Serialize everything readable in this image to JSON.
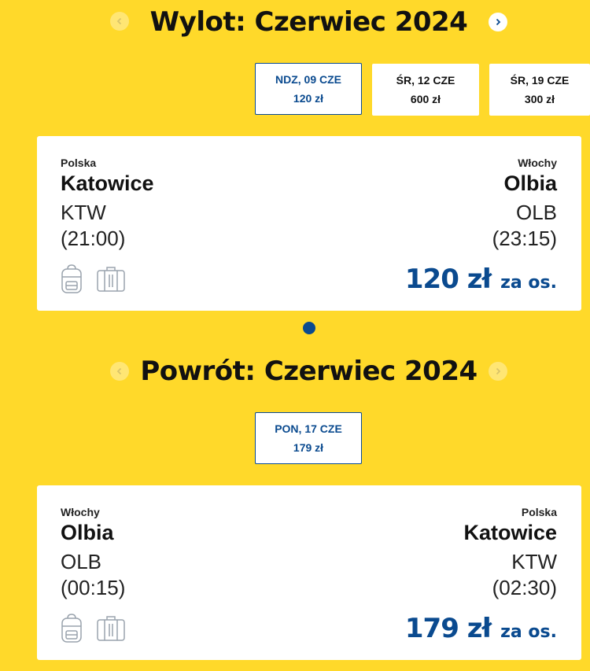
{
  "outbound": {
    "title": "Wylot: Czerwiec 2024",
    "dates": [
      {
        "date": "NDZ, 09 CZE",
        "price": "120 zł",
        "selected": true
      },
      {
        "date": "ŚR, 12 CZE",
        "price": "600 zł",
        "selected": false
      },
      {
        "date": "ŚR, 19 CZE",
        "price": "300 zł",
        "selected": false
      }
    ],
    "flight": {
      "from_country": "Polska",
      "from_city": "Katowice",
      "from_code": "KTW",
      "from_time": "(21:00)",
      "to_country": "Włochy",
      "to_city": "Olbia",
      "to_code": "OLB",
      "to_time": "(23:15)",
      "price": "120 zł",
      "per": "za os."
    }
  },
  "return": {
    "title": "Powrót: Czerwiec 2024",
    "dates": [
      {
        "date": "PON, 17 CZE",
        "price": "179 zł",
        "selected": true
      }
    ],
    "flight": {
      "from_country": "Włochy",
      "from_city": "Olbia",
      "from_code": "OLB",
      "from_time": "(00:15)",
      "to_country": "Polska",
      "to_city": "Katowice",
      "to_code": "KTW",
      "to_time": "(02:30)",
      "price": "179 zł",
      "per": "za os."
    }
  },
  "icons": {
    "prev": "chevron-left-icon",
    "next": "chevron-right-icon",
    "backpack": "backpack-icon",
    "suitcase": "suitcase-icon"
  },
  "colors": {
    "background": "#FFD92A",
    "accent": "#0A4A8F"
  }
}
